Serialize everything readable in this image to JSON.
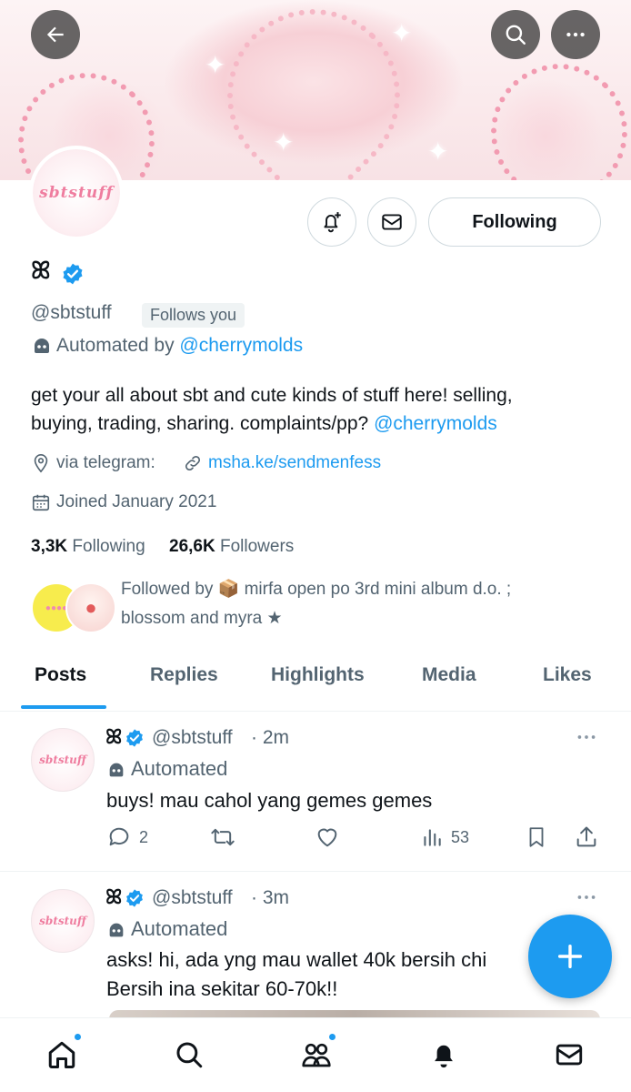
{
  "profile": {
    "display_name": "ꕤ",
    "handle": "@sbtstuff",
    "follows_you": "Follows you",
    "automated_prefix": "Automated by ",
    "automated_by": "@cherrymolds",
    "avatar_text": "sbtstuff",
    "bio_line1": "get your all about sbt and cute kinds of stuff here! selling,",
    "bio_line2": "buying, trading, sharing. complaints/pp? ",
    "bio_mention": "@cherrymolds",
    "location": "via telegram:",
    "link": "msha.ke/sendmenfess",
    "joined": "Joined January 2021",
    "following_count": "3,3K",
    "following_label": "Following",
    "followers_count": "26,6K",
    "followers_label": "Followers",
    "followed_by_line1": "Followed by 📦 mirfa open po 3rd mini album d.o. ;",
    "followed_by_line2": "blossom and myra ★",
    "following_button": "Following"
  },
  "tabs": [
    "Posts",
    "Replies",
    "Highlights",
    "Media",
    "Likes"
  ],
  "posts": [
    {
      "display_name": "ꕤ",
      "handle": "@sbtstuff",
      "time": "· 2m",
      "automated": "Automated",
      "text": "buys! mau cahol yang gemes gemes",
      "replies": "2",
      "views": "53"
    },
    {
      "display_name": "ꕤ",
      "handle": "@sbtstuff",
      "time": "· 3m",
      "automated": "Automated",
      "text_line1": "asks! hi, ada yng mau wallet 40k bersih chi",
      "text_line2": "Bersih ina sekitar 60-70k!!"
    }
  ],
  "colors": {
    "accent": "#1d9bf0",
    "verified": "#1d9bf0",
    "secondary_text": "#536471"
  }
}
